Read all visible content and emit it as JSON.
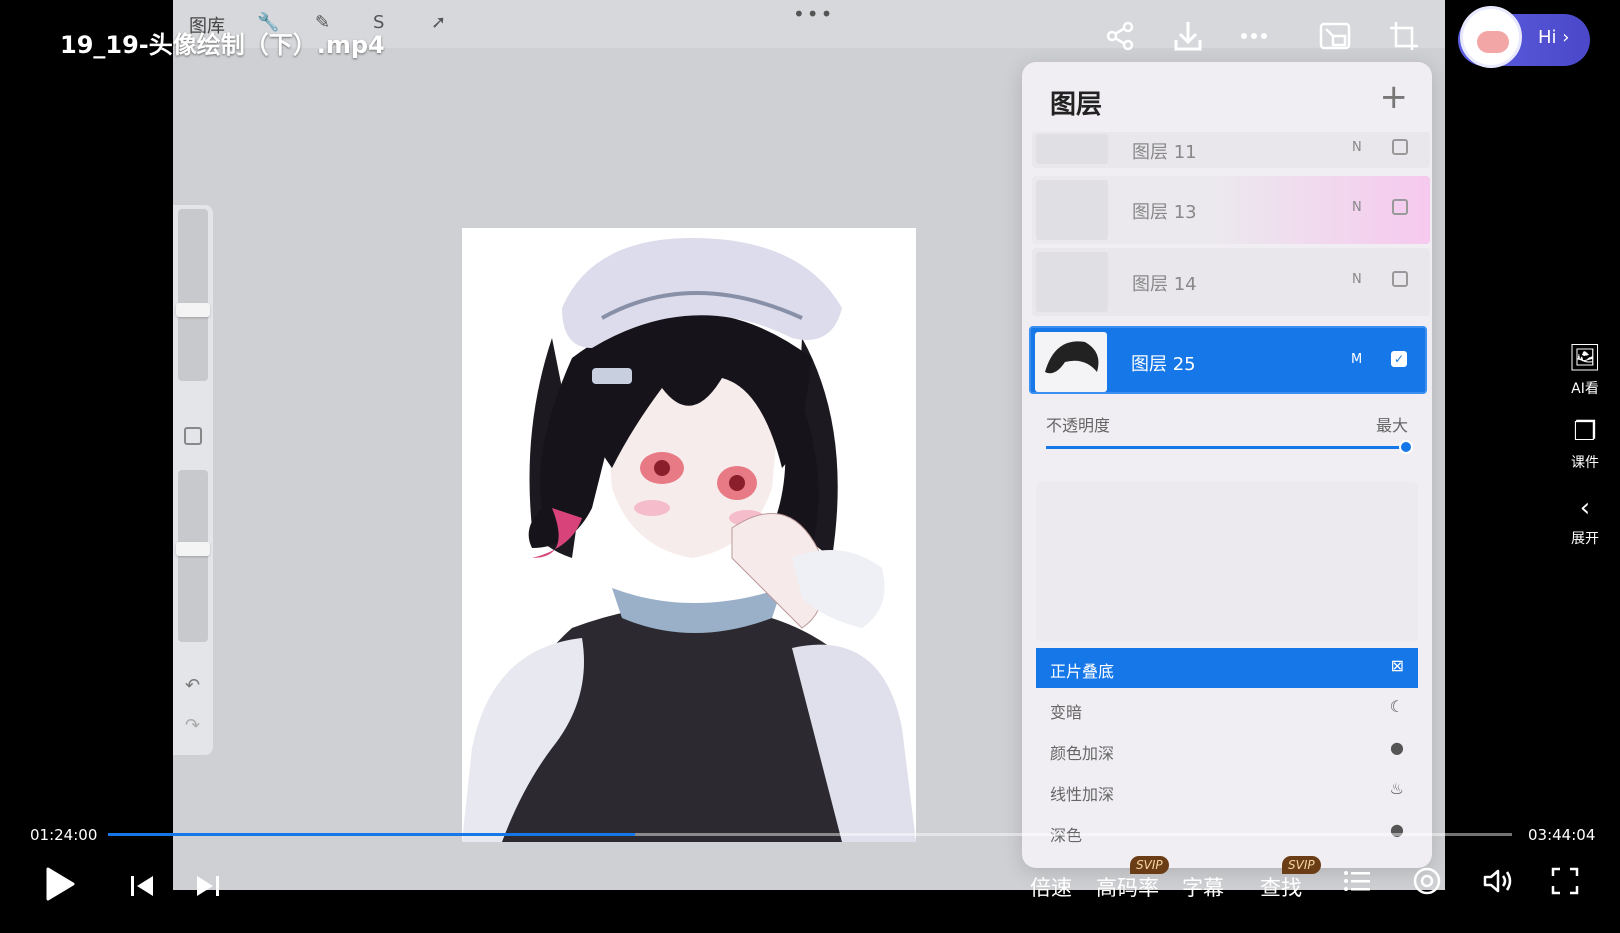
{
  "video": {
    "title": "19_19-头像绘制（下）.mp4",
    "current_time": "01:24:00",
    "total_time": "03:44:04",
    "progress": 0.375
  },
  "procreate": {
    "gallery_label": "图库",
    "layers_panel": {
      "title": "图层",
      "layers": [
        {
          "name": "图层 11",
          "mode": "N",
          "checked": false,
          "active": false
        },
        {
          "name": "图层 13",
          "mode": "N",
          "checked": false,
          "active": false
        },
        {
          "name": "图层 14",
          "mode": "N",
          "checked": false,
          "active": false
        },
        {
          "name": "图层 25",
          "mode": "M",
          "checked": true,
          "active": true
        }
      ],
      "opacity_label": "不透明度",
      "opacity_value": "最大",
      "blend_modes": [
        {
          "label": "正片叠底",
          "icon": "multiply-icon",
          "selected": true
        },
        {
          "label": "变暗",
          "icon": "moon-icon",
          "selected": false
        },
        {
          "label": "颜色加深",
          "icon": "burn-icon",
          "selected": false
        },
        {
          "label": "线性加深",
          "icon": "flame-icon",
          "selected": false
        },
        {
          "label": "深色",
          "icon": "circle-icon",
          "selected": false
        }
      ]
    }
  },
  "top_overlay": {
    "hi_label": "Hi ›",
    "actions": [
      "share-icon",
      "download-icon",
      "more-icon",
      "pip-icon",
      "crop-icon"
    ]
  },
  "side_tools": [
    {
      "label": "AI看",
      "icon": "ai-view-icon"
    },
    {
      "label": "课件",
      "icon": "courseware-icon"
    },
    {
      "label": "展开",
      "icon": "chevron-left-icon"
    }
  ],
  "controls": {
    "speed": "倍速",
    "quality": "高码率",
    "subtitles": "字幕",
    "search": "查找",
    "svip": "SVIP"
  },
  "colors": {
    "accent": "#1677e8",
    "hi_button": "#5b5fe0"
  }
}
